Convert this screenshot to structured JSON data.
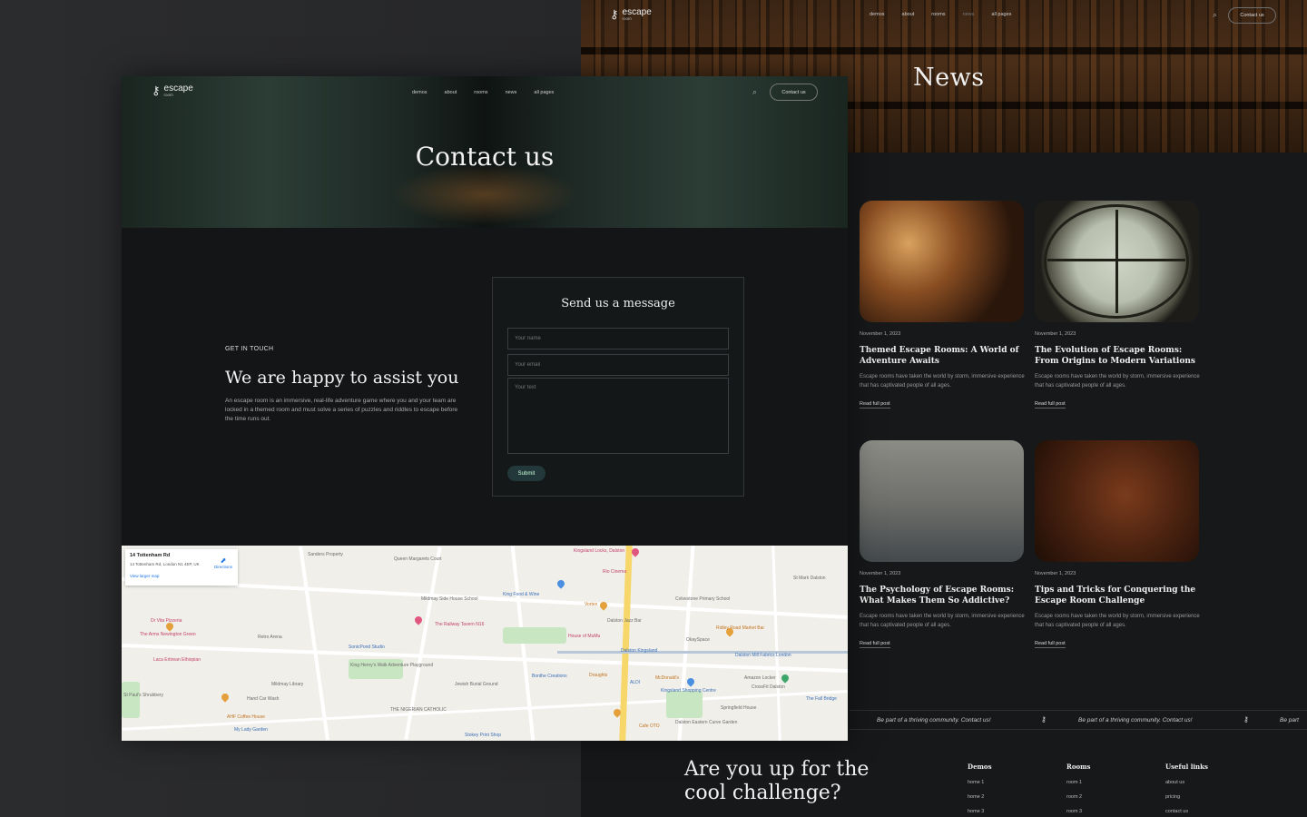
{
  "news_page": {
    "logo": {
      "main": "escape",
      "sub": "room"
    },
    "nav": [
      "demos",
      "about",
      "rooms",
      "news",
      "all pages"
    ],
    "contact_button": "Contact us",
    "title": "News",
    "posts": [
      {
        "date": "November 1, 2023",
        "title": "Themed Escape Rooms: A World of Adventure Awaits",
        "excerpt": "Escape rooms have taken the world by storm, immersive experience that has captivated people of all ages.",
        "link": "Read full post"
      },
      {
        "date": "November 1, 2023",
        "title": "The Evolution of Escape Rooms: From Origins to Modern Variations",
        "excerpt": "Escape rooms have taken the world by storm, immersive experience that has captivated people of all ages.",
        "link": "Read full post"
      },
      {
        "date": "November 1, 2023",
        "title": "The Psychology of Escape Rooms: What Makes Them So Addictive?",
        "excerpt": "Escape rooms have taken the world by storm, immersive experience that has captivated people of all ages.",
        "link": "Read full post"
      },
      {
        "date": "November 1, 2023",
        "title": "Tips and Tricks for Conquering the Escape Room Challenge",
        "excerpt": "Escape rooms have taken the world by storm, immersive experience that has captivated people of all ages.",
        "link": "Read full post"
      }
    ],
    "ticker": [
      "Be part of a thriving community. Contact us!",
      "Be part of a thriving community. Contact us!",
      "Be part"
    ],
    "footer": {
      "cta": [
        "Are you up for the",
        "cool challenge?"
      ],
      "columns": [
        {
          "heading": "Demos",
          "items": [
            "home 1",
            "home 2",
            "home 3"
          ]
        },
        {
          "heading": "Rooms",
          "items": [
            "room 1",
            "room 2",
            "room 3"
          ]
        },
        {
          "heading": "Useful links",
          "items": [
            "about us",
            "pricing",
            "contact us"
          ]
        }
      ]
    }
  },
  "contact_page": {
    "logo": {
      "main": "escape",
      "sub": "room"
    },
    "nav": [
      "demos",
      "about",
      "rooms",
      "news",
      "all pages"
    ],
    "contact_button": "Contact us",
    "title": "Contact us",
    "eyebrow": "GET IN TOUCH",
    "heading": "We are happy to assist you",
    "body": "An escape room is an immersive, real-life adventure game where you and your team are locked in a themed room and must solve a series of puzzles and riddles to escape before the time runs out.",
    "form": {
      "title": "Send us a message",
      "name_placeholder": "Your name",
      "email_placeholder": "Your email",
      "text_placeholder": "Your text",
      "submit": "Submit"
    },
    "map": {
      "card_title": "14 Tottenham Rd",
      "card_address": "14 Tottenham Rd, London N1 4EP, UK",
      "card_link": "View larger map",
      "card_directions": "Directions",
      "labels": [
        "Sanders Property",
        "Queen Margarets Court",
        "Kingsland Locks, Dalston",
        "Mildmay Side House School",
        "King Food & Wine",
        "Rio Cinema",
        "St Mark Dalston",
        "Colvestone Primary School",
        "Dr Vita Pizzeria",
        "The Arms Newington Green",
        "Retro Arena",
        "The Railway Tavern N16",
        "Dalston Jazz Bar",
        "Ridley Road Market Bar",
        "SonicPond Studio",
        "House of MuMu",
        "Dalston Kingsland",
        "Laca Eritrean Ethiopian",
        "St Paul's Shrubbery",
        "King Henry's Walk Adventure Playground",
        "Jewish Burial Ground",
        "Bonthe Creations",
        "Dalston Mill Fabrics London",
        "CrossFit Dalston",
        "The Fall Bridge",
        "Hand Car Wash",
        "THE NIGERIAN CATHOLIC",
        "Kingsland Shopping Centre",
        "Springfield House",
        "AHF Coffee House",
        "My Lady Garden",
        "Dalston Eastern Curve Garden",
        "Cafe OTO",
        "Stokey Print Shop",
        "Amazon Locker",
        "Mildmay Library",
        "Draughts",
        "McDonald's",
        "ALDI",
        "OkaySpace",
        "Vortex"
      ]
    }
  }
}
